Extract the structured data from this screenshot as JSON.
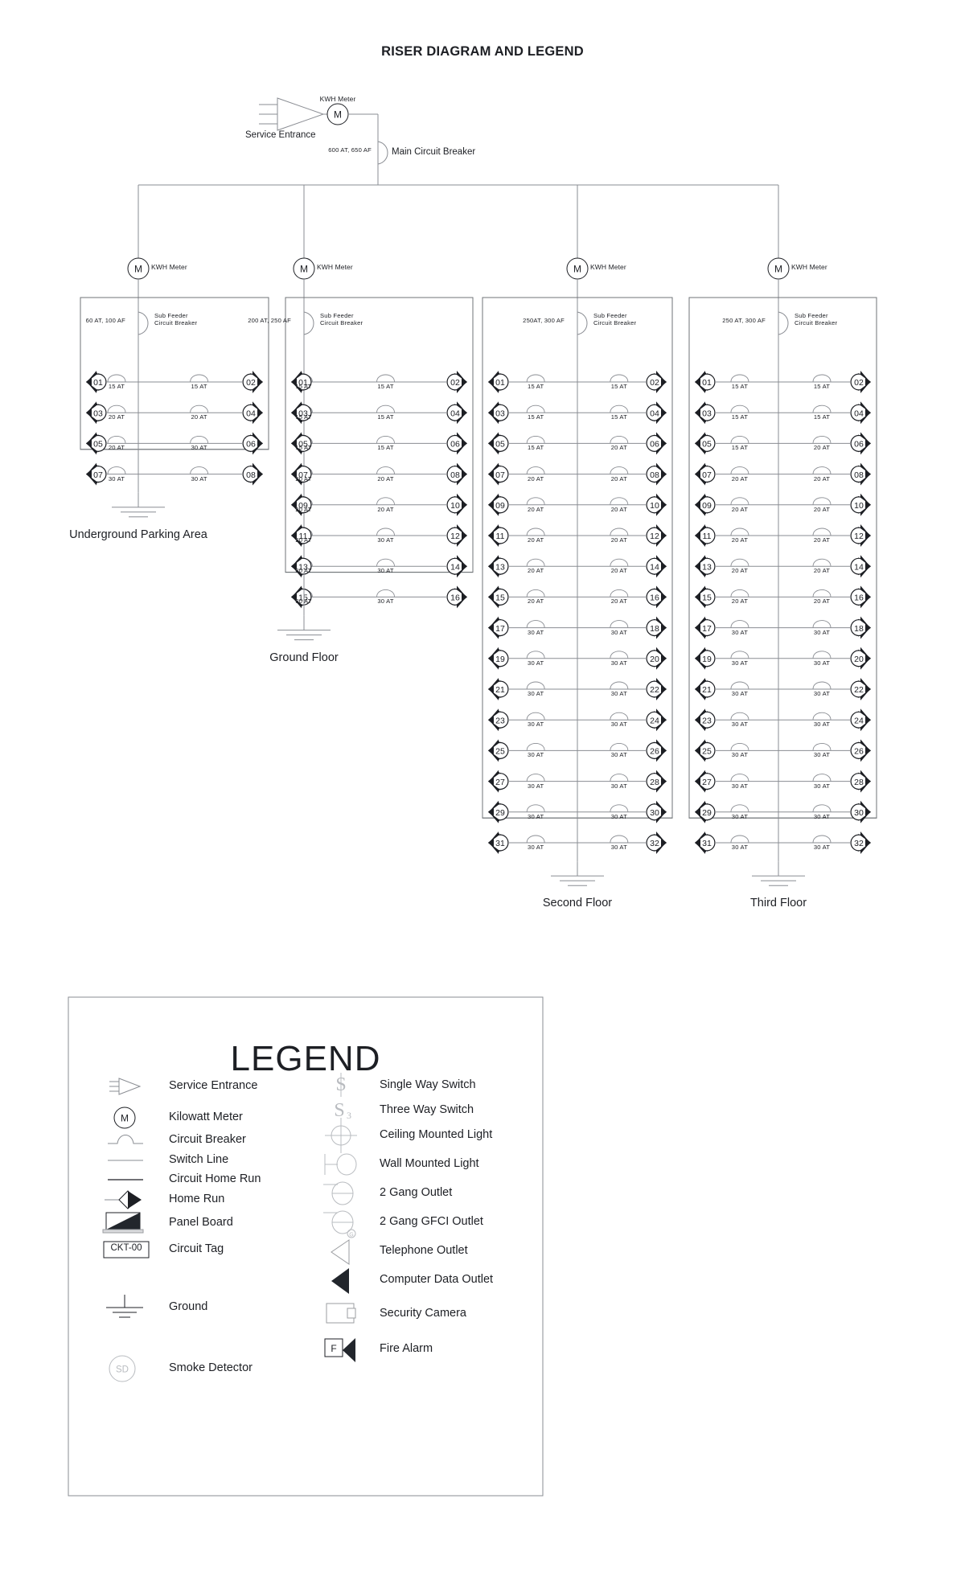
{
  "title": "RISER DIAGRAM AND LEGEND",
  "service": {
    "entrance_label": "Service Entrance",
    "meter_label": "KWH Meter",
    "main_breaker_rating": "600 AT, 650 AF",
    "main_breaker_label": "Main Circuit Breaker"
  },
  "panels": [
    {
      "meter_label": "KWH Meter",
      "feeder_rating": "60 AT, 100 AF",
      "feeder_label_line1": "Sub Feeder",
      "feeder_label_line2": "Circuit Breaker",
      "floor_label": "Underground Parking Area",
      "rows": [
        {
          "left_ckt": "01",
          "left_at": "15 AT",
          "right_at": "15 AT",
          "right_ckt": "02"
        },
        {
          "left_ckt": "03",
          "left_at": "20 AT",
          "right_at": "20 AT",
          "right_ckt": "04"
        },
        {
          "left_ckt": "05",
          "left_at": "20 AT",
          "right_at": "30 AT",
          "right_ckt": "06"
        },
        {
          "left_ckt": "07",
          "left_at": "30 AT",
          "right_at": "30 AT",
          "right_ckt": "08"
        }
      ]
    },
    {
      "meter_label": "KWH Meter",
      "feeder_rating": "200 AT, 250 AF",
      "feeder_label_line1": "Sub Feeder",
      "feeder_label_line2": "Circuit Breaker",
      "floor_label": "Ground Floor",
      "rows": [
        {
          "left_ckt": "01",
          "left_at": "15 AT",
          "right_at": "15 AT",
          "right_ckt": "02"
        },
        {
          "left_ckt": "03",
          "left_at": "15 AT",
          "right_at": "15 AT",
          "right_ckt": "04"
        },
        {
          "left_ckt": "05",
          "left_at": "15 AT",
          "right_at": "15 AT",
          "right_ckt": "06"
        },
        {
          "left_ckt": "07",
          "left_at": "20 AT",
          "right_at": "20 AT",
          "right_ckt": "08"
        },
        {
          "left_ckt": "09",
          "left_at": "20 AT",
          "right_at": "20 AT",
          "right_ckt": "10"
        },
        {
          "left_ckt": "11",
          "left_at": "20 AT",
          "right_at": "30 AT",
          "right_ckt": "12"
        },
        {
          "left_ckt": "13",
          "left_at": "30 AT",
          "right_at": "30 AT",
          "right_ckt": "14"
        },
        {
          "left_ckt": "15",
          "left_at": "30 AT",
          "right_at": "30 AT",
          "right_ckt": "16"
        }
      ]
    },
    {
      "meter_label": "KWH Meter",
      "feeder_rating": "250AT, 300 AF",
      "feeder_label_line1": "Sub Feeder",
      "feeder_label_line2": "Circuit Breaker",
      "floor_label": "Second Floor",
      "rows": [
        {
          "left_ckt": "01",
          "left_at": "15 AT",
          "right_at": "15 AT",
          "right_ckt": "02"
        },
        {
          "left_ckt": "03",
          "left_at": "15 AT",
          "right_at": "15 AT",
          "right_ckt": "04"
        },
        {
          "left_ckt": "05",
          "left_at": "15 AT",
          "right_at": "20 AT",
          "right_ckt": "06"
        },
        {
          "left_ckt": "07",
          "left_at": "20 AT",
          "right_at": "20 AT",
          "right_ckt": "08"
        },
        {
          "left_ckt": "09",
          "left_at": "20 AT",
          "right_at": "20 AT",
          "right_ckt": "10"
        },
        {
          "left_ckt": "11",
          "left_at": "20 AT",
          "right_at": "20 AT",
          "right_ckt": "12"
        },
        {
          "left_ckt": "13",
          "left_at": "20 AT",
          "right_at": "20 AT",
          "right_ckt": "14"
        },
        {
          "left_ckt": "15",
          "left_at": "20 AT",
          "right_at": "20 AT",
          "right_ckt": "16"
        },
        {
          "left_ckt": "17",
          "left_at": "30 AT",
          "right_at": "30 AT",
          "right_ckt": "18"
        },
        {
          "left_ckt": "19",
          "left_at": "30 AT",
          "right_at": "30 AT",
          "right_ckt": "20"
        },
        {
          "left_ckt": "21",
          "left_at": "30 AT",
          "right_at": "30 AT",
          "right_ckt": "22"
        },
        {
          "left_ckt": "23",
          "left_at": "30 AT",
          "right_at": "30 AT",
          "right_ckt": "24"
        },
        {
          "left_ckt": "25",
          "left_at": "30 AT",
          "right_at": "30 AT",
          "right_ckt": "26"
        },
        {
          "left_ckt": "27",
          "left_at": "30 AT",
          "right_at": "30 AT",
          "right_ckt": "28"
        },
        {
          "left_ckt": "29",
          "left_at": "30 AT",
          "right_at": "30 AT",
          "right_ckt": "30"
        },
        {
          "left_ckt": "31",
          "left_at": "30 AT",
          "right_at": "30 AT",
          "right_ckt": "32"
        }
      ]
    },
    {
      "meter_label": "KWH Meter",
      "feeder_rating": "250 AT, 300 AF",
      "feeder_label_line1": "Sub Feeder",
      "feeder_label_line2": "Circuit Breaker",
      "floor_label": "Third Floor",
      "rows": [
        {
          "left_ckt": "01",
          "left_at": "15 AT",
          "right_at": "15 AT",
          "right_ckt": "02"
        },
        {
          "left_ckt": "03",
          "left_at": "15 AT",
          "right_at": "15 AT",
          "right_ckt": "04"
        },
        {
          "left_ckt": "05",
          "left_at": "15 AT",
          "right_at": "20 AT",
          "right_ckt": "06"
        },
        {
          "left_ckt": "07",
          "left_at": "20 AT",
          "right_at": "20 AT",
          "right_ckt": "08"
        },
        {
          "left_ckt": "09",
          "left_at": "20 AT",
          "right_at": "20 AT",
          "right_ckt": "10"
        },
        {
          "left_ckt": "11",
          "left_at": "20 AT",
          "right_at": "20 AT",
          "right_ckt": "12"
        },
        {
          "left_ckt": "13",
          "left_at": "20 AT",
          "right_at": "20 AT",
          "right_ckt": "14"
        },
        {
          "left_ckt": "15",
          "left_at": "20 AT",
          "right_at": "20 AT",
          "right_ckt": "16"
        },
        {
          "left_ckt": "17",
          "left_at": "30 AT",
          "right_at": "30 AT",
          "right_ckt": "18"
        },
        {
          "left_ckt": "19",
          "left_at": "30 AT",
          "right_at": "30 AT",
          "right_ckt": "20"
        },
        {
          "left_ckt": "21",
          "left_at": "30 AT",
          "right_at": "30 AT",
          "right_ckt": "22"
        },
        {
          "left_ckt": "23",
          "left_at": "30 AT",
          "right_at": "30 AT",
          "right_ckt": "24"
        },
        {
          "left_ckt": "25",
          "left_at": "30 AT",
          "right_at": "30 AT",
          "right_ckt": "26"
        },
        {
          "left_ckt": "27",
          "left_at": "30 AT",
          "right_at": "30 AT",
          "right_ckt": "28"
        },
        {
          "left_ckt": "29",
          "left_at": "30 AT",
          "right_at": "30 AT",
          "right_ckt": "30"
        },
        {
          "left_ckt": "31",
          "left_at": "30 AT",
          "right_at": "30 AT",
          "right_ckt": "32"
        }
      ]
    }
  ],
  "legend": {
    "title": "LEGEND",
    "left_items": [
      {
        "icon": "service-entrance-icon",
        "label": "Service Entrance"
      },
      {
        "icon": "kilowatt-meter-icon",
        "label": "Kilowatt Meter"
      },
      {
        "icon": "circuit-breaker-icon",
        "label": "Circuit Breaker"
      },
      {
        "icon": "switch-line-icon",
        "label": "Switch Line"
      },
      {
        "icon": "circuit-home-run-icon",
        "label": "Circuit Home Run"
      },
      {
        "icon": "home-run-icon",
        "label": "Home Run"
      },
      {
        "icon": "panel-board-icon",
        "label": "Panel Board"
      },
      {
        "icon": "circuit-tag-icon",
        "label": "Circuit Tag",
        "tag_text": "CKT-00"
      },
      {
        "icon": "ground-icon",
        "label": "Ground"
      },
      {
        "icon": "smoke-detector-icon",
        "label": "Smoke Detector",
        "tag_text": "SD"
      }
    ],
    "right_items": [
      {
        "icon": "single-way-switch-icon",
        "label": "Single Way Switch"
      },
      {
        "icon": "three-way-switch-icon",
        "label": "Three Way Switch"
      },
      {
        "icon": "ceiling-mounted-light-icon",
        "label": "Ceiling Mounted Light"
      },
      {
        "icon": "wall-mounted-light-icon",
        "label": "Wall Mounted Light"
      },
      {
        "icon": "two-gang-outlet-icon",
        "label": "2 Gang Outlet"
      },
      {
        "icon": "two-gang-gfci-outlet-icon",
        "label": "2 Gang GFCI Outlet"
      },
      {
        "icon": "telephone-outlet-icon",
        "label": "Telephone Outlet"
      },
      {
        "icon": "computer-data-outlet-icon",
        "label": "Computer Data Outlet"
      },
      {
        "icon": "security-camera-icon",
        "label": "Security Camera"
      },
      {
        "icon": "fire-alarm-icon",
        "label": "Fire Alarm",
        "tag_text": "F"
      }
    ]
  },
  "colors": {
    "line": "#8a8d93",
    "dark": "#1d1f24",
    "panel_border": "#6f7377"
  }
}
